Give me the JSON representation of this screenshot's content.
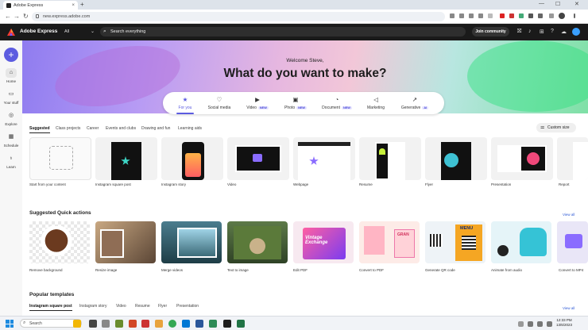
{
  "browser": {
    "tab_title": "Adobe Express",
    "tab_close": "×",
    "new_tab": "+",
    "back": "←",
    "forward": "→",
    "reload": "↻",
    "url": "new.express.adobe.com",
    "win_min": "—",
    "win_max": "☐",
    "win_close": "✕"
  },
  "appbar": {
    "brand": "Adobe Express",
    "filter_value": "All",
    "search_placeholder": "Search everything",
    "join_label": "Join community"
  },
  "rail": {
    "create_label": "+",
    "items": [
      {
        "label": "Home",
        "icon": "home-icon"
      },
      {
        "label": "Your stuff",
        "icon": "folder-icon"
      },
      {
        "label": "Explore",
        "icon": "compass-icon"
      },
      {
        "label": "Schedule",
        "icon": "calendar-icon"
      },
      {
        "label": "Learn",
        "icon": "lightbulb-icon"
      }
    ]
  },
  "hero": {
    "welcome": "Welcome Steve,",
    "headline": "What do you want to make?"
  },
  "categories": [
    {
      "label": "For you",
      "icon": "star-icon",
      "badge": ""
    },
    {
      "label": "Social media",
      "icon": "thumbs-up-icon",
      "badge": ""
    },
    {
      "label": "Video",
      "icon": "play-icon",
      "badge": "NEW"
    },
    {
      "label": "Photo",
      "icon": "image-icon",
      "badge": "NEW"
    },
    {
      "label": "Document",
      "icon": "document-icon",
      "badge": "NEW"
    },
    {
      "label": "Marketing",
      "icon": "megaphone-icon",
      "badge": ""
    },
    {
      "label": "Generative",
      "icon": "sparkle-icon",
      "badge": "AI"
    }
  ],
  "filters": [
    "Suggested",
    "Class projects",
    "Career",
    "Events and clubs",
    "Drawing and fun",
    "Learning aids"
  ],
  "custom_size_label": "Custom size",
  "templates": [
    "Start from your content",
    "Instagram square post",
    "Instagram story",
    "Video",
    "Webpage",
    "Resume",
    "Flyer",
    "Presentation",
    "Report"
  ],
  "quick_actions": {
    "title": "Suggested Quick actions",
    "view_all": "View all",
    "items": [
      "Remove background",
      "Resize image",
      "Merge videos",
      "Text to image",
      "Edit PDF",
      "Convert to PDF",
      "Generate QR code",
      "Animate from audio",
      "Convert to MP4"
    ]
  },
  "thumb_text": {
    "vintage": "Vintage Exchange",
    "menu": "MENU",
    "gran": "GRAN"
  },
  "popular": {
    "title": "Popular templates",
    "view_all": "View all",
    "tabs": [
      "Instagram square post",
      "Instagram story",
      "Video",
      "Resume",
      "Flyer",
      "Presentation"
    ]
  },
  "taskbar": {
    "search_placeholder": "Search",
    "time": "12:33 PM",
    "date": "13/6/2023"
  },
  "colors": {
    "accent": "#5c5ce0",
    "appbar": "#1a1a1a"
  }
}
